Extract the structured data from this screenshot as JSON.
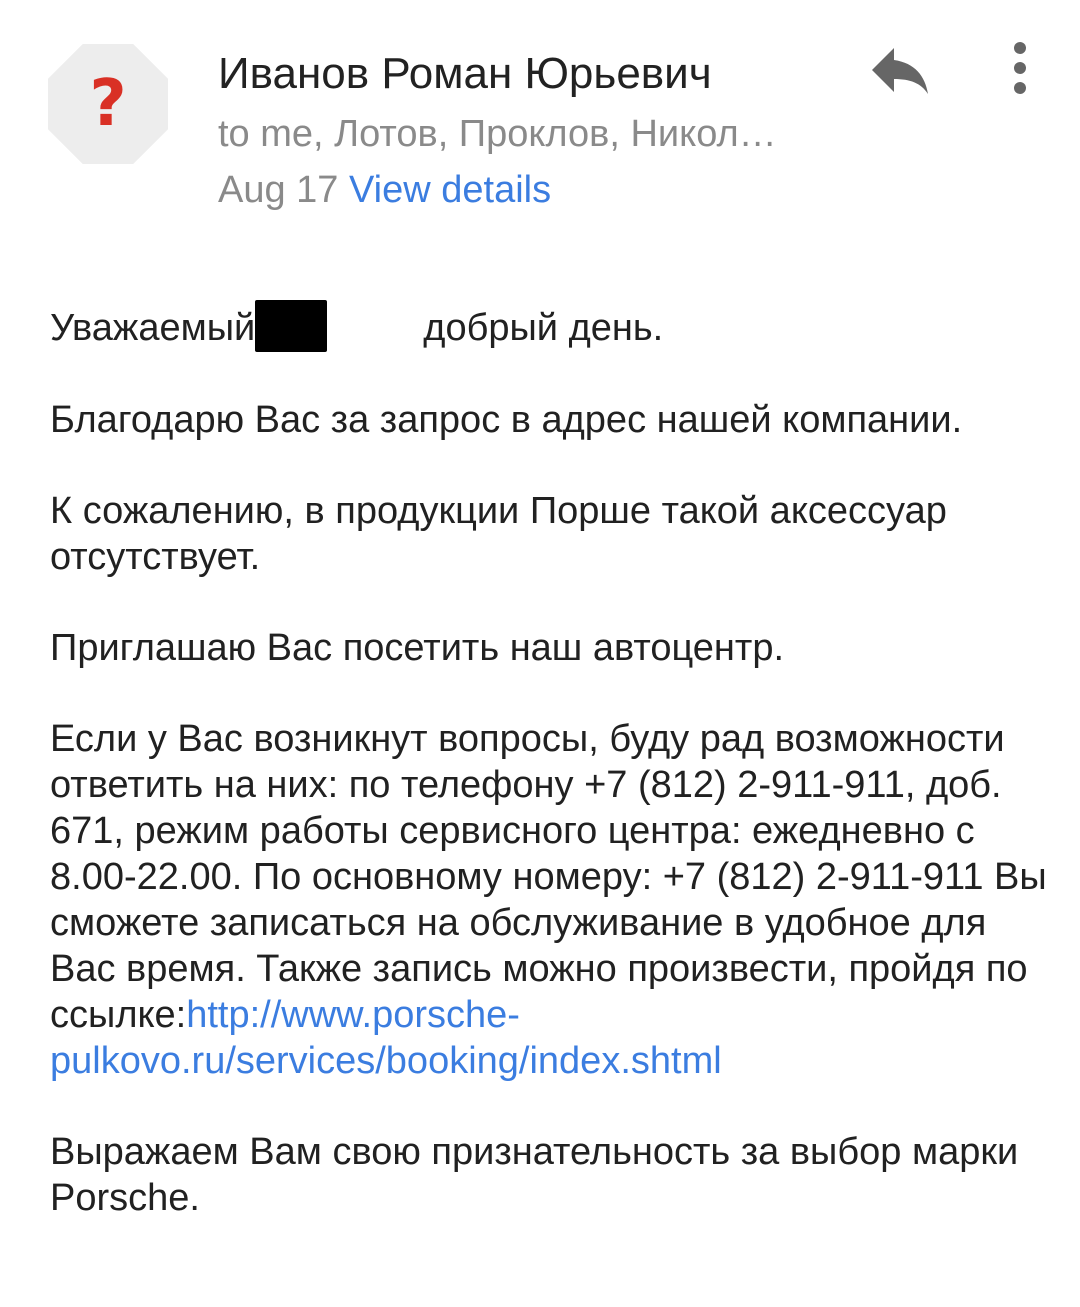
{
  "header": {
    "avatar_glyph": "?",
    "sender_name": "Иванов Роман Юрьевич",
    "recipients": "to me, Лотов, Проклов, Никол…",
    "date": "Aug 17",
    "view_details_label": "View details",
    "reply_icon": "reply-icon",
    "more_icon": "more-vert-icon"
  },
  "body": {
    "greeting_prefix": "Уважаемый",
    "greeting_suffix": "добрый день.",
    "p1": "Благодарю Вас за запрос в адрес нашей компании.",
    "p2": "К сожалению, в продукции Порше такой аксессуар отсутствует.",
    "p3": "Приглашаю Вас посетить наш автоцентр.",
    "p4_text": "Если у Вас возникнут вопросы, буду рад возможности ответить на них: по телефону +7 (812) 2-911-911, доб. 671, режим работы сервисного центра: ежедневно с 8.00-22.00. По основному номеру: +7 (812) 2-911-911 Вы сможете записаться на обслуживание в удобное для Вас время. Также запись можно произвести, пройдя по ссылке:",
    "p4_link": "http://www.porsche-pulkovo.ru/services/booking/index.shtml",
    "p5": "Выражаем Вам свою признательность за выбор марки Porsche."
  },
  "colors": {
    "link": "#3b7de0",
    "secondary_text": "#8a8a8a",
    "avatar_bg": "#ededed",
    "avatar_glyph": "#d93025"
  }
}
